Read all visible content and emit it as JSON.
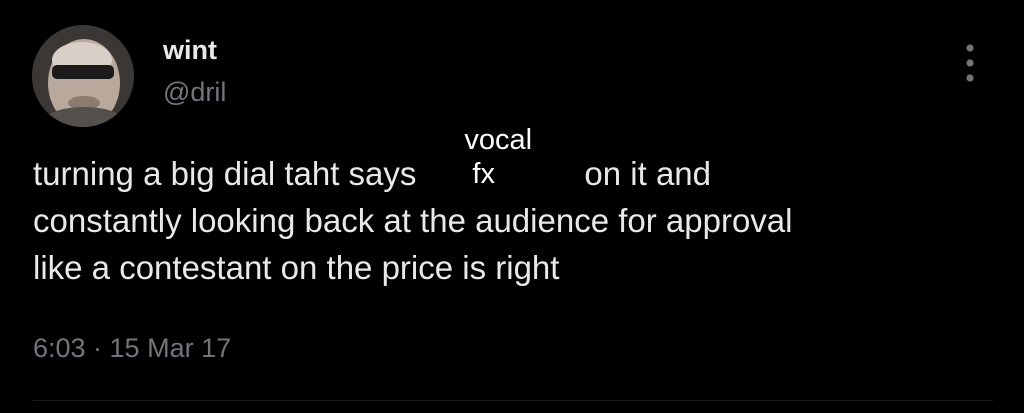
{
  "author": {
    "display_name": "wint",
    "handle": "@dril"
  },
  "menu": {
    "icon": "more-vertical-icon"
  },
  "tweet": {
    "text_part1": "turning a big dial taht says",
    "dial_label_top": "vocal",
    "dial_label_bottom": "fx",
    "text_part2": "on it and",
    "line2": "constantly looking back at the audience for approval",
    "line3": "like a contestant on the price is right",
    "timestamp": "6:03 · 15 Mar 17"
  },
  "colors": {
    "background": "#000000",
    "primary_text": "#e7e9ea",
    "secondary_text": "#71767b"
  }
}
